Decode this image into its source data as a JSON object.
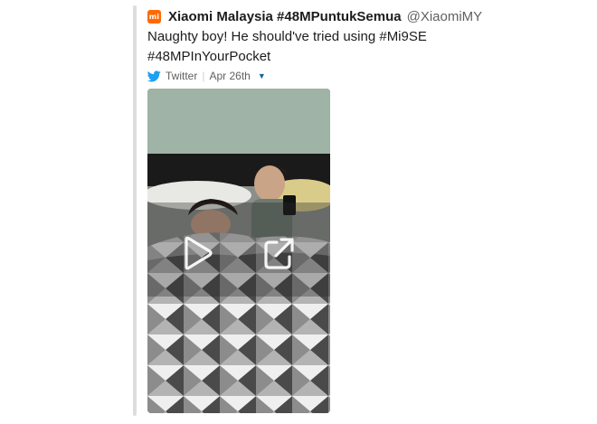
{
  "tweet": {
    "author_name": "Xiaomi Malaysia #48MPuntukSemua",
    "author_handle": "@XiaomiMY",
    "brand_icon_text": "mi",
    "brand_color": "#ff6900",
    "text_lines": [
      "Naughty boy! He should've tried using #Mi9SE",
      "#48MPInYourPocket"
    ],
    "source": "Twitter",
    "date": "Apr 26th",
    "source_icon": "twitter-bird-icon",
    "twitter_color": "#1da1f2"
  },
  "media": {
    "type": "video",
    "play_icon": "play-icon",
    "open_icon": "open-external-icon"
  }
}
